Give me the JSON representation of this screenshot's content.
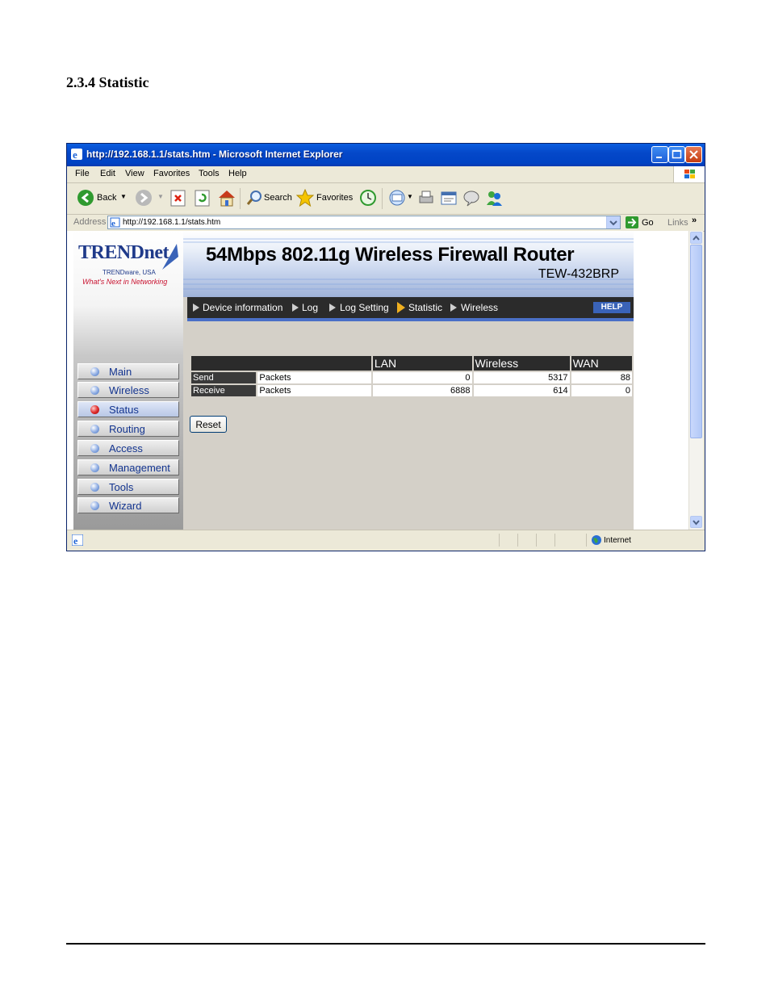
{
  "document": {
    "heading": "2.3.4  Statistic"
  },
  "browser": {
    "title": "http://192.168.1.1/stats.htm - Microsoft Internet Explorer",
    "menu": [
      "File",
      "Edit",
      "View",
      "Favorites",
      "Tools",
      "Help"
    ],
    "toolbar": {
      "back_label": "Back",
      "search_label": "Search",
      "favorites_label": "Favorites"
    },
    "address": {
      "label": "Address",
      "url": "http://192.168.1.1/stats.htm",
      "go_label": "Go",
      "links_label": "Links"
    },
    "status": {
      "zone": "Internet"
    }
  },
  "router": {
    "logo": {
      "brand": "TRENDnet",
      "sub1": "TRENDware, USA",
      "sub2": "What's Next in Networking"
    },
    "banner": {
      "title": "54Mbps 802.11g Wireless Firewall Router",
      "model": "TEW-432BRP"
    },
    "nav": [
      {
        "label": "Main",
        "active": false
      },
      {
        "label": "Wireless",
        "active": false
      },
      {
        "label": "Status",
        "active": true
      },
      {
        "label": "Routing",
        "active": false
      },
      {
        "label": "Access",
        "active": false
      },
      {
        "label": "Management",
        "active": false
      },
      {
        "label": "Tools",
        "active": false
      },
      {
        "label": "Wizard",
        "active": false
      }
    ],
    "breadcrumbs": [
      "Device information",
      "Log",
      "Log Setting",
      "Statistic",
      "Wireless"
    ],
    "help_label": "HELP",
    "stats": {
      "headers": [
        "LAN",
        "Wireless",
        "WAN"
      ],
      "rows": [
        {
          "label": "Send",
          "type": "Packets",
          "lan": "0",
          "wireless": "5317",
          "wan": "88"
        },
        {
          "label": "Receive",
          "type": "Packets",
          "lan": "6888",
          "wireless": "614",
          "wan": "0"
        }
      ]
    },
    "reset_label": "Reset"
  }
}
